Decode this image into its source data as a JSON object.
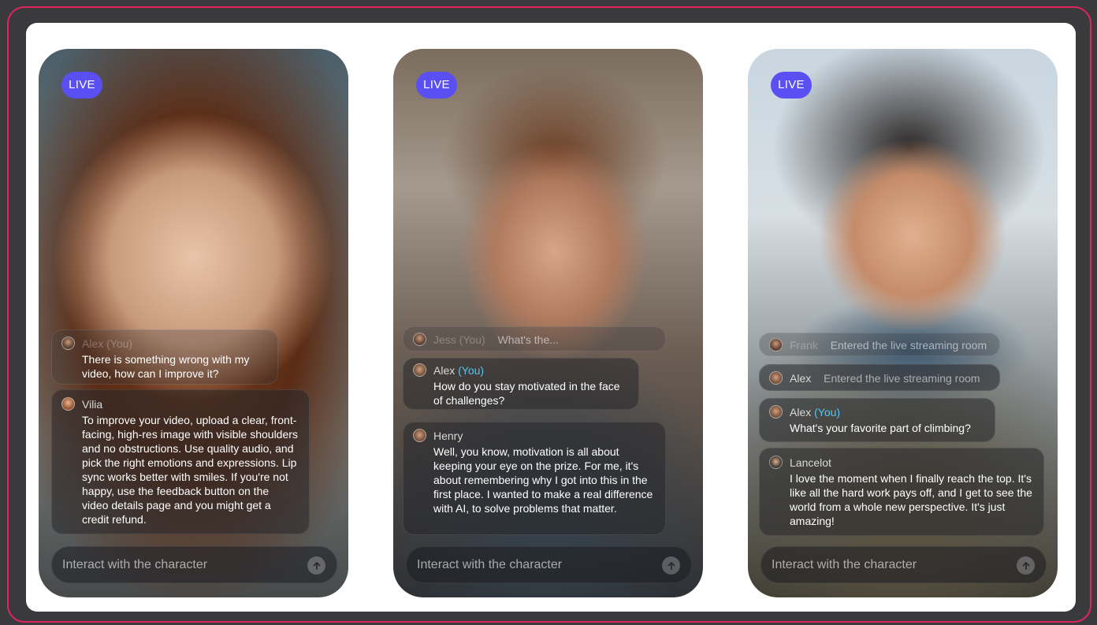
{
  "cards": [
    {
      "live_label": "LIVE",
      "messages": [
        {
          "name": "Alex",
          "you": "(You)",
          "text": "There is something wrong with my video, how can I improve it?"
        },
        {
          "name": "Vilia",
          "text": "To improve your video, upload a clear, front-facing, high-res image with visible shoulders and no obstructions. Use quality audio, and pick the right emotions and expressions. Lip sync works better with smiles. If you're not happy, use the feedback button on the video details page and you might get a credit refund."
        }
      ],
      "input_placeholder": "Interact with the character"
    },
    {
      "live_label": "LIVE",
      "messages": [
        {
          "name": "Jess",
          "you": "(You)",
          "text": "What's the..."
        },
        {
          "name": "Alex",
          "you": "(You)",
          "text": "How do you stay motivated in the face of challenges?"
        },
        {
          "name": "Henry",
          "text": "Well, you know, motivation is all about keeping your eye on the prize. For me, it's about remembering why I got into this in the first place. I wanted to make a real difference with AI, to solve problems that matter."
        }
      ],
      "input_placeholder": "Interact with the character"
    },
    {
      "live_label": "LIVE",
      "messages": [
        {
          "name": "Frank",
          "meta": "Entered the live streaming room"
        },
        {
          "name": "Alex",
          "meta": "Entered the live streaming room"
        },
        {
          "name": "Alex",
          "you": "(You)",
          "text": "What's your favorite part of climbing?"
        },
        {
          "name": "Lancelot",
          "text": "I love the moment when I finally reach the top. It's like all the hard work pays off, and I get to see the world from a whole new perspective. It's just amazing!"
        }
      ],
      "input_placeholder": "Interact with the character"
    }
  ],
  "colors": {
    "live_badge": "#5a4ff2",
    "you_highlight": "#4fc8f4",
    "frame_border": "#e0245e"
  }
}
